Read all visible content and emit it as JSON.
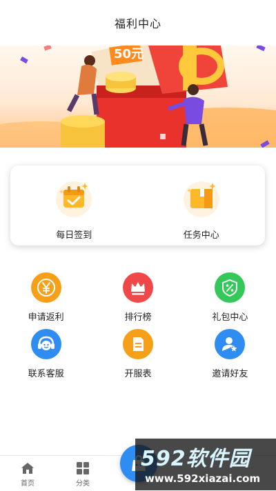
{
  "header": {
    "title": "福利中心"
  },
  "banner": {
    "coupon_text": "50元"
  },
  "card": {
    "items": [
      {
        "label": "每日签到",
        "icon": "calendar-check-icon"
      },
      {
        "label": "任务中心",
        "icon": "task-box-icon"
      }
    ]
  },
  "grid": {
    "items": [
      {
        "label": "申请返利",
        "icon": "yen-icon",
        "color": "#f6a01a"
      },
      {
        "label": "排行榜",
        "icon": "crown-icon",
        "color": "#f04848"
      },
      {
        "label": "礼包中心",
        "icon": "gift-percent-icon",
        "color": "#34c85a"
      },
      {
        "label": "联系客服",
        "icon": "customer-service-icon",
        "color": "#2f8cf0"
      },
      {
        "label": "开服表",
        "icon": "server-list-icon",
        "color": "#f6a01a"
      },
      {
        "label": "邀请好友",
        "icon": "invite-friend-icon",
        "color": "#2f8cf0"
      }
    ]
  },
  "tabbar": {
    "items": [
      {
        "label": "首页",
        "icon": "home-icon"
      },
      {
        "label": "分类",
        "icon": "category-icon"
      }
    ]
  },
  "watermark": {
    "logo": "592软件园",
    "url": "www.592xiazai.com"
  }
}
